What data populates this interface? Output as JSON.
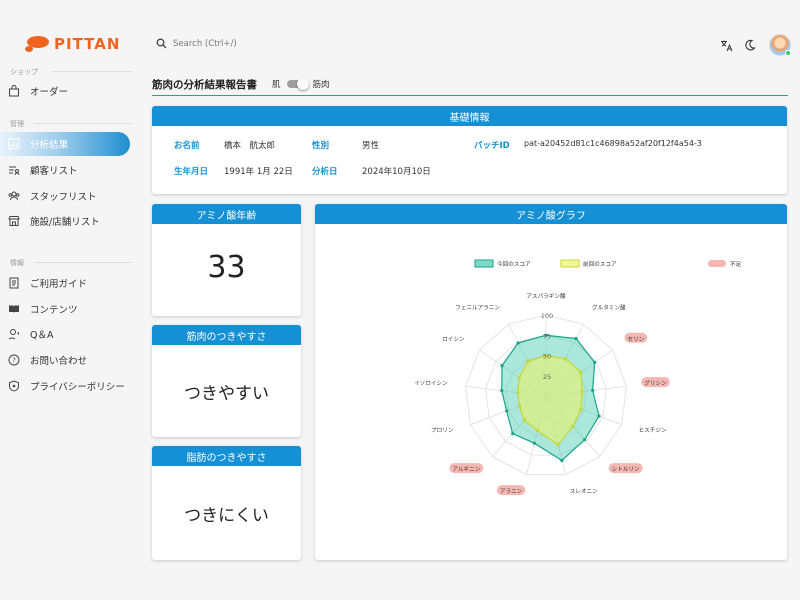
{
  "brand": {
    "name": "PITTAN",
    "color": "#f0641e"
  },
  "sidebar": {
    "sections": [
      {
        "label": "ショップ",
        "items": [
          {
            "label": "オーダー",
            "icon": "bag-icon"
          }
        ]
      },
      {
        "label": "管理",
        "items": [
          {
            "label": "分析結果",
            "icon": "chart-icon",
            "active": true
          },
          {
            "label": "顧客リスト",
            "icon": "customer-list-icon"
          },
          {
            "label": "スタッフリスト",
            "icon": "staff-icon"
          },
          {
            "label": "施設/店舗リスト",
            "icon": "store-icon"
          }
        ]
      },
      {
        "label": "情報",
        "items": [
          {
            "label": "ご利用ガイド",
            "icon": "guide-icon"
          },
          {
            "label": "コンテンツ",
            "icon": "book-icon"
          },
          {
            "label": "Q＆A",
            "icon": "qa-icon"
          },
          {
            "label": "お問い合わせ",
            "icon": "help-icon"
          },
          {
            "label": "プライバシーポリシー",
            "icon": "shield-icon"
          }
        ]
      }
    ]
  },
  "topbar": {
    "search_placeholder": "Search (Ctrl+/)",
    "icons": [
      "translate-icon",
      "moon-icon"
    ]
  },
  "page": {
    "title": "筋肉の分析結果報告書",
    "toggle_left": "肌",
    "toggle_right": "筋肉"
  },
  "basic_info": {
    "header": "基礎情報",
    "name_label": "お名前",
    "name_value": "橋本　航太郎",
    "gender_label": "性別",
    "gender_value": "男性",
    "patch_label": "パッチID",
    "patch_value": "pat-a20452d81c1c46898a52af20f12f4a54-3",
    "birth_label": "生年月日",
    "birth_value": "1991年 1月 22日",
    "analysis_label": "分析日",
    "analysis_value": "2024年10月10日"
  },
  "amino_age": {
    "header": "アミノ酸年齢",
    "value": "33"
  },
  "muscle_ease": {
    "header": "筋肉のつきやすさ",
    "value": "つきやすい"
  },
  "fat_ease": {
    "header": "脂肪のつきやすさ",
    "value": "つきにくい"
  },
  "amino_graph": {
    "header": "アミノ酸グラフ"
  },
  "chart_data": {
    "type": "radar",
    "categories": [
      "アスパラギン酸",
      "グルタミン酸",
      "セリン",
      "グリシン",
      "ヒスチジン",
      "シトルリン",
      "スレオニン",
      "アラニン",
      "アルギニン",
      "プロリン",
      "イソロイシン",
      "ロイシン",
      "フェニルアラニン"
    ],
    "deficient": [
      false,
      false,
      true,
      true,
      false,
      true,
      false,
      true,
      true,
      false,
      false,
      false,
      false
    ],
    "ticks": [
      "25",
      "50",
      "75",
      "100"
    ],
    "rmax": 100,
    "series": [
      {
        "name": "今回のスコア",
        "values": [
          75,
          80,
          73,
          58,
          70,
          72,
          82,
          60,
          62,
          52,
          55,
          66,
          74
        ],
        "stroke": "#17a589",
        "fill": "#48c9b0"
      },
      {
        "name": "前回のスコア",
        "values": [
          50,
          52,
          52,
          45,
          46,
          50,
          62,
          44,
          40,
          35,
          35,
          40,
          48
        ],
        "stroke": "#c8d632",
        "fill": "#e8f36a"
      }
    ],
    "deficient_label": "不足",
    "deficient_color": "#f5b7b1",
    "legend_position": "top"
  }
}
